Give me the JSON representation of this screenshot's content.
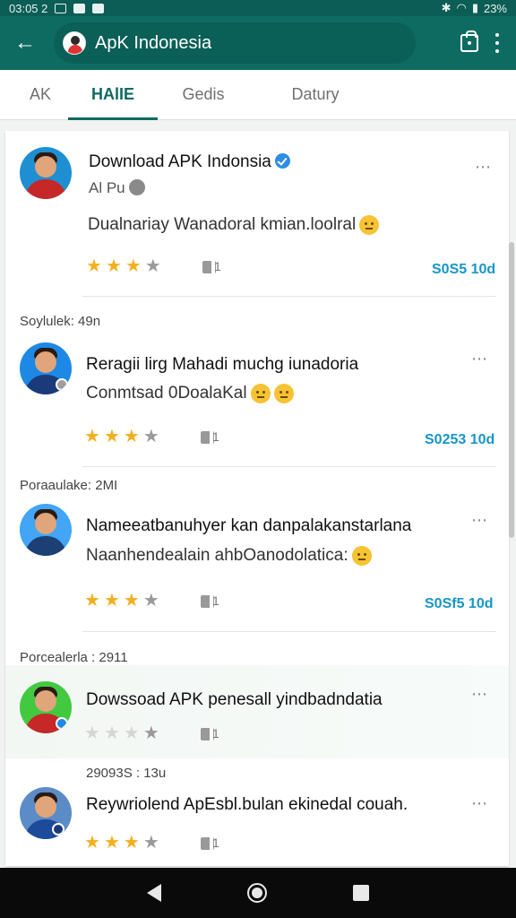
{
  "status_bar": {
    "time": "03:05 2",
    "battery": "23%"
  },
  "app_bar": {
    "title": "ApK Indonesia"
  },
  "tabs": [
    {
      "label": "AK"
    },
    {
      "label": "HAlIE",
      "active": true
    },
    {
      "label": "Gedis"
    },
    {
      "label": "Datury"
    }
  ],
  "posts": [
    {
      "title": "Download APK Indonsia",
      "author": "Al Pu",
      "text": "Dualnariay Wanadoral kmian.loolral",
      "rating": 2.5,
      "comment_count": "1",
      "timestamp": "S0S5 10d"
    },
    {
      "section_label": "Soylulek: 49n",
      "title": "Reragii lirg Mahadi muchg iunadoria",
      "text": "Conmtsad 0DoalaKal",
      "rating": 2.5,
      "comment_count": "1",
      "timestamp": "S0253 10d"
    },
    {
      "section_label": "Poraaulake: 2MI",
      "title": "Nameeatbanuhyer kan danpalakanstarlana",
      "text": "Naanhendealain ahbOanodolatica:",
      "rating": 2.5,
      "comment_count": "1",
      "timestamp": "S0Sf5 10d"
    },
    {
      "section_label": "Porcealerla : 2911",
      "title": "Dowssoad APK penesall yindbadndatia",
      "rating": 0,
      "comment_count": "1"
    },
    {
      "section_label": "29093S : 13u",
      "title": "Reywriolend ApEsbl.bulan ekinedal couah.",
      "rating": 2.5,
      "comment_count": "1"
    }
  ],
  "colors": {
    "primary": "#0e6b62",
    "accent_link": "#1795c9",
    "star": "#f2b01e"
  }
}
